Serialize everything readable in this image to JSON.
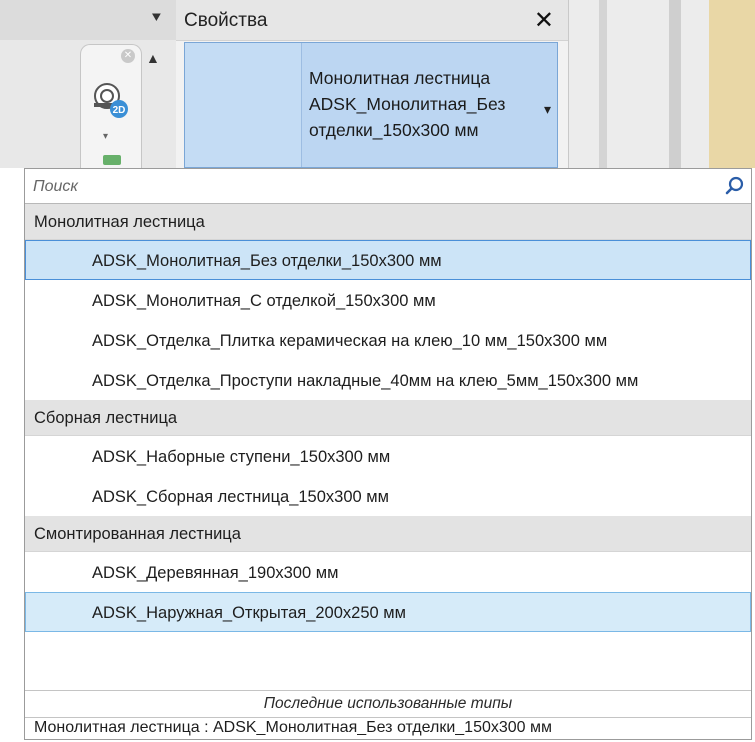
{
  "properties_panel": {
    "title": "Свойства",
    "close_glyph": "✕",
    "type_selector_name": "Монолитная лестница ADSK_Монолитная_Без отделки_150x300 мм",
    "dropdown_glyph": "▾"
  },
  "icons": {
    "navigation": "2d-navigation-icon",
    "search": "search-icon"
  },
  "dropdown": {
    "search_placeholder": "Поиск",
    "groups": [
      {
        "name": "Монолитная лестница",
        "items": [
          "ADSK_Монолитная_Без отделки_150x300 мм",
          "ADSK_Монолитная_С отделкой_150x300 мм",
          "ADSK_Отделка_Плитка керамическая на клею_10 мм_150x300 мм",
          "ADSK_Отделка_Проступи накладные_40мм на клею_5мм_150x300 мм"
        ]
      },
      {
        "name": "Сборная лестница",
        "items": [
          "ADSK_Наборные ступени_150x300 мм",
          "ADSK_Сборная лестница_150x300 мм"
        ]
      },
      {
        "name": "Смонтированная лестница",
        "items": [
          "ADSK_Деревянная_190x300 мм",
          "ADSK_Наружная_Открытая_200x250 мм"
        ]
      }
    ],
    "selected_item": "ADSK_Монолитная_Без отделки_150x300 мм",
    "hovered_item": "ADSK_Наружная_Открытая_200x250 мм",
    "recent_header": "Последние использованные типы",
    "recent_items": [
      "Монолитная лестница : ADSK_Монолитная_Без отделки_150x300 мм"
    ]
  },
  "colors": {
    "selection_fill": "#cce4f7",
    "selection_border": "#4a8fd8",
    "group_header_bg": "#e3e3e3"
  }
}
